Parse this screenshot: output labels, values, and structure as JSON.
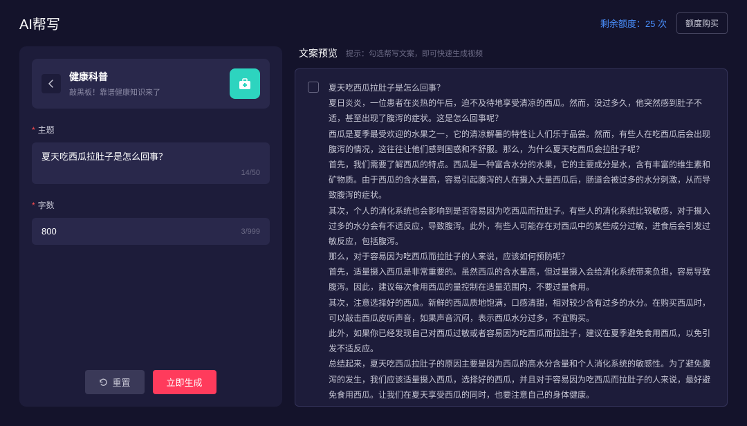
{
  "header": {
    "title": "AI帮写",
    "quota_label": "剩余额度：",
    "quota_amount": "25 次",
    "buy_button": "额度购买"
  },
  "category": {
    "title": "健康科普",
    "desc": "敲黑板！靠谱健康知识来了"
  },
  "form": {
    "topic_label": "主题",
    "topic_value": "夏天吃西瓜拉肚子是怎么回事？",
    "topic_count": "14/50",
    "words_label": "字数",
    "words_value": "800",
    "words_count": "3/999"
  },
  "actions": {
    "reset": "重置",
    "generate": "立即生成"
  },
  "preview": {
    "title": "文案预览",
    "hint_prefix": "提示：",
    "hint_text": "勾选帮写文案，即可快速生成视频",
    "text": "夏天吃西瓜拉肚子是怎么回事？\n夏日炎炎，一位患者在炎热的午后，迫不及待地享受清凉的西瓜。然而，没过多久，他突然感到肚子不适，甚至出现了腹泻的症状。这是怎么回事呢？\n西瓜是夏季最受欢迎的水果之一，它的清凉解暑的特性让人们乐于品尝。然而，有些人在吃西瓜后会出现腹泻的情况，这往往让他们感到困惑和不舒服。那么，为什么夏天吃西瓜会拉肚子呢？\n首先，我们需要了解西瓜的特点。西瓜是一种富含水分的水果，它的主要成分是水，含有丰富的维生素和矿物质。由于西瓜的含水量高，容易引起腹泻的人在摄入大量西瓜后，肠道会被过多的水分刺激，从而导致腹泻的症状。\n其次，个人的消化系统也会影响到是否容易因为吃西瓜而拉肚子。有些人的消化系统比较敏感，对于摄入过多的水分会有不适反应，导致腹泻。此外，有些人可能存在对西瓜中的某些成分过敏，进食后会引发过敏反应，包括腹泻。\n那么，对于容易因为吃西瓜而拉肚子的人来说，应该如何预防呢？\n首先，适量摄入西瓜是非常重要的。虽然西瓜的含水量高，但过量摄入会给消化系统带来负担，容易导致腹泻。因此，建议每次食用西瓜的量控制在适量范围内，不要过量食用。\n其次，注意选择好的西瓜。新鲜的西瓜质地饱满，口感清甜，相对较少含有过多的水分。在购买西瓜时，可以敲击西瓜皮听声音，如果声音沉闷，表示西瓜水分过多，不宜购买。\n此外，如果你已经发现自己对西瓜过敏或者容易因为吃西瓜而拉肚子，建议在夏季避免食用西瓜，以免引发不适反应。\n总结起来，夏天吃西瓜拉肚子的原因主要是因为西瓜的高水分含量和个人消化系统的敏感性。为了避免腹泻的发生，我们应该适量摄入西瓜，选择好的西瓜，并且对于容易因为吃西瓜而拉肚子的人来说，最好避免食用西瓜。让我们在夏天享受西瓜的同时，也要注意自己的身体健康。"
  }
}
